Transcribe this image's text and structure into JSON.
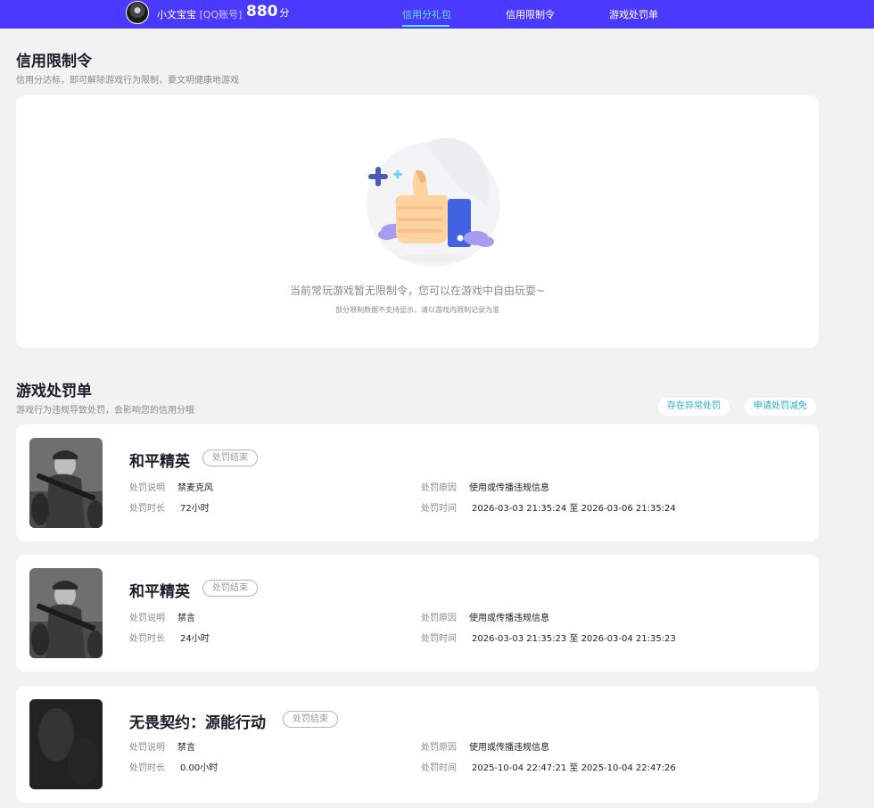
{
  "header": {
    "username": "小文宝宝",
    "account_type": "[QQ账号]",
    "score": "880",
    "score_unit": "分",
    "nav": [
      {
        "label": "信用分礼包",
        "active": true
      },
      {
        "label": "信用限制令",
        "active": false
      },
      {
        "label": "游戏处罚单",
        "active": false
      }
    ]
  },
  "restriction": {
    "title": "信用限制令",
    "subtitle": "信用分达标，即可解除游戏行为限制，要文明健康地游戏",
    "empty_message": "当前常玩游戏暂无限制令，您可以在游戏中自由玩耍~",
    "empty_note": "部分限制数据不支持显示，请以游戏内限制记录为准"
  },
  "penalty": {
    "title": "游戏处罚单",
    "subtitle": "游戏行为违规导致处罚，会影响您的信用分哦",
    "btn_abnormal": "存在异常处罚",
    "btn_reduce": "申请处罚减免",
    "labels": {
      "desc": "处罚说明",
      "duration": "处罚时长",
      "reason": "处罚原因",
      "time": "处罚时间"
    },
    "items": [
      {
        "game": "和平精英",
        "status": "处罚结束",
        "desc": "禁麦克风",
        "duration": "72小时",
        "reason": "使用或传播违规信息",
        "time": "2026-03-03 21:35:24 至 2026-03-06 21:35:24"
      },
      {
        "game": "和平精英",
        "status": "处罚结束",
        "desc": "禁言",
        "duration": "24小时",
        "reason": "使用或传播违规信息",
        "time": "2026-03-03 21:35:23 至 2026-03-04 21:35:23"
      },
      {
        "game": "无畏契约：源能行动",
        "status": "处罚结束",
        "desc": "禁言",
        "duration": "0.00小时",
        "reason": "使用或传播违规信息",
        "time": "2025-10-04 22:47:21 至 2025-10-04 22:47:26"
      }
    ]
  },
  "colors": {
    "topbar": "#4a3aff",
    "nav_active": "#5fe0f6",
    "accent_link": "#22b3cf"
  }
}
